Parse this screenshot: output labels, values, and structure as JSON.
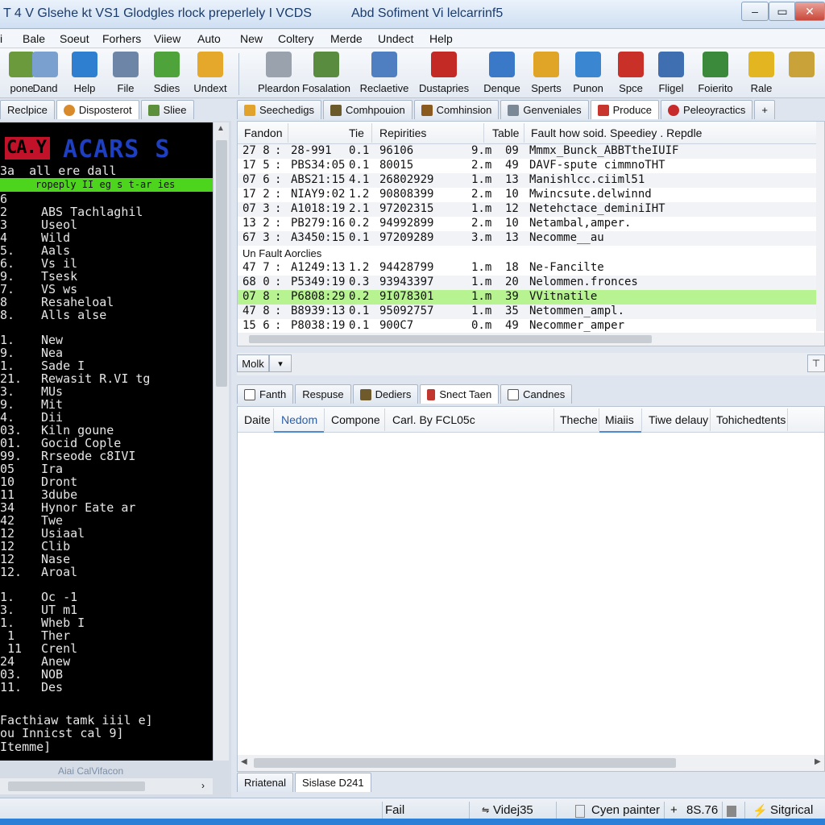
{
  "window": {
    "title_left": "T 4 V Glsehe kt VS1 Glodgles rlock preperlely I VCDS",
    "title_right": "Abd Sofiment Vi lelcarrinf5",
    "btn_min": "–",
    "btn_max": "▭",
    "btn_close": "✕"
  },
  "menu": [
    "Bale",
    "Soeut",
    "Forhers",
    "Viiew",
    "Auto",
    "New",
    "Coltery",
    "Merde",
    "Undect",
    "Help"
  ],
  "toolbar": [
    {
      "label": "pone",
      "icon": "globe-icon",
      "color": "#6a9a3c"
    },
    {
      "label": "Dand",
      "icon": "document-icon",
      "color": "#7aa0d0"
    },
    {
      "label": "Help",
      "icon": "help-globe-icon",
      "color": "#2f7fd0"
    },
    {
      "label": "File",
      "icon": "monitor-icon",
      "color": "#6d86a8"
    },
    {
      "label": "Sdies",
      "icon": "puzzle-icon",
      "color": "#4ea33a"
    },
    {
      "label": "Undext",
      "icon": "folder-icon",
      "color": "#e5a82b"
    },
    {
      "label": "Pleardon",
      "icon": "flask-icon",
      "color": "#9aa3ad"
    },
    {
      "label": "Fosalation",
      "icon": "chart-icon",
      "color": "#5a8c3f"
    },
    {
      "label": "Reclaetive",
      "icon": "screen-icon",
      "color": "#4f7fc0"
    },
    {
      "label": "Dustapries",
      "icon": "m-logo-icon",
      "color": "#c42a25"
    },
    {
      "label": "Denque",
      "icon": "question-doc-icon",
      "color": "#3a78c8"
    },
    {
      "label": "Sperts",
      "icon": "windows-icon",
      "color": "#e0a526"
    },
    {
      "label": "Punon",
      "icon": "orb-icon",
      "color": "#3a86d0"
    },
    {
      "label": "Spce",
      "icon": "stop-icon",
      "color": "#c93128"
    },
    {
      "label": "Fligel",
      "icon": "globe-stand-icon",
      "color": "#3f6fb0"
    },
    {
      "label": "Foierito",
      "icon": "bars-icon",
      "color": "#3b8a3b"
    },
    {
      "label": "Rale",
      "icon": "tag-icon",
      "color": "#e2b521"
    },
    {
      "label": "",
      "icon": "network-icon",
      "color": "#c9a23a"
    }
  ],
  "left_tabs": [
    {
      "label": "Reclpice",
      "icon": ""
    },
    {
      "label": "Disposterot",
      "icon": "gear-icon"
    },
    {
      "label": "Sliee",
      "icon": "grid-icon"
    }
  ],
  "right_tabs": [
    {
      "label": "Seechedigs",
      "icon": "pencil-icon"
    },
    {
      "label": "Comhpouion",
      "icon": "chip-icon"
    },
    {
      "label": "Comhinsion",
      "icon": "chip-icon"
    },
    {
      "label": "Genveniales",
      "icon": "table-icon"
    },
    {
      "label": "Produce",
      "icon": "flag-icon"
    },
    {
      "label": "Peleoyractics",
      "icon": "stop-icon"
    },
    {
      "label": "+",
      "icon": ""
    }
  ],
  "terminal": {
    "logo": "CA.Y",
    "logo2": "ACARS S",
    "header": "3a  all ere dall",
    "green_bar": "ropeply II  eg s t-ar ies",
    "rows": [
      {
        "n": "6",
        "t": ""
      },
      {
        "n": "2",
        "t": "ABS Tachlaghil"
      },
      {
        "n": "3",
        "t": "Useol"
      },
      {
        "n": "4",
        "t": "Wild"
      },
      {
        "n": "5.",
        "t": "Aals"
      },
      {
        "n": "6.",
        "t": "Vs il"
      },
      {
        "n": "9.",
        "t": "Tsesk"
      },
      {
        "n": "7.",
        "t": "VS ws"
      },
      {
        "n": "8",
        "t": "Resaheloal"
      },
      {
        "n": "8.",
        "t": "Alls alse"
      },
      {
        "n": "",
        "t": ""
      },
      {
        "n": "1.",
        "t": "New"
      },
      {
        "n": "9.",
        "t": "Nea"
      },
      {
        "n": "1.",
        "t": "Sade I"
      },
      {
        "n": "21.",
        "t": "Rewasit R.VI tg"
      },
      {
        "n": "3.",
        "t": "MUs"
      },
      {
        "n": "9.",
        "t": "Mit"
      },
      {
        "n": "4.",
        "t": "Dii"
      },
      {
        "n": "03.",
        "t": "Kiln goune"
      },
      {
        "n": "01.",
        "t": "Gocid Cople"
      },
      {
        "n": "99.",
        "t": "Rrseode c8IVI"
      },
      {
        "n": "05",
        "t": "Ira"
      },
      {
        "n": "10",
        "t": "Dront"
      },
      {
        "n": "11",
        "t": "3dube"
      },
      {
        "n": "34",
        "t": "Hynor Eate ar"
      },
      {
        "n": "42",
        "t": "Twe"
      },
      {
        "n": "12",
        "t": "Usiaal"
      },
      {
        "n": "12",
        "t": "Clib"
      },
      {
        "n": "12",
        "t": "Nase"
      },
      {
        "n": "12.",
        "t": "Aroal"
      },
      {
        "n": "",
        "t": ""
      },
      {
        "n": "1.",
        "t": "Oc -1"
      },
      {
        "n": "3.",
        "t": "UT m1"
      },
      {
        "n": "1.",
        "t": "Wheb I"
      },
      {
        "n": " 1",
        "t": "Ther"
      },
      {
        "n": " 11",
        "t": "Crenl"
      },
      {
        "n": "24",
        "t": "Anew"
      },
      {
        "n": "03.",
        "t": "NOB"
      },
      {
        "n": "11.",
        "t": "Des"
      }
    ],
    "footer": [
      "Facthiaw tamk iiil e]",
      "ou Innicst cal 9]",
      "Itemme]"
    ],
    "watermark": "Aiai CalVifacon"
  },
  "upper_table": {
    "headers": [
      "Fandon",
      "Tie",
      "Repirities",
      "Table",
      "Fault how soid. Speediey . Repdle"
    ],
    "rows": [
      {
        "a": "27 8",
        "b": ":",
        "c": "28-991",
        "d": "0.1",
        "e": "96106",
        "f": "9.m",
        "g": "09",
        "h": "Mmmx_Bunck_ABBTtheIUIF"
      },
      {
        "a": "17 5",
        "b": ":",
        "c": "PBS34:05",
        "d": "0.1",
        "e": "80015",
        "f": "2.m",
        "g": "49",
        "h": "DAVF-spute cimmnoTHT"
      },
      {
        "a": "07 6",
        "b": ":",
        "c": "ABS21:15",
        "d": "4.1",
        "e": "26802929",
        "f": "1.m",
        "g": "13",
        "h": "Manishlcc.ciiml51"
      },
      {
        "a": "17 2",
        "b": ":",
        "c": "NIAY9:02",
        "d": "1.2",
        "e": "90808399",
        "f": "2.m",
        "g": "10",
        "h": "Mwincsute.delwinnd"
      },
      {
        "a": "07 3",
        "b": ":",
        "c": "A1018:19",
        "d": "2.1",
        "e": "97202315",
        "f": "1.m",
        "g": "12",
        "h": "Netehctace_deminiIHT"
      },
      {
        "a": "13 2",
        "b": ":",
        "c": "PB279:16",
        "d": "0.2",
        "e": "94992899",
        "f": "2.m",
        "g": "10",
        "h": "Netambal,amper."
      },
      {
        "a": "67 3",
        "b": ":",
        "c": "A3450:15",
        "d": "0.1",
        "e": "97209289",
        "f": "3.m",
        "g": "13",
        "h": "Necomme__au"
      }
    ],
    "section": "Un Fault Aorclies",
    "rows2": [
      {
        "a": "47 7",
        "b": ":",
        "c": "A1249:13",
        "d": "1.2",
        "e": "94428799",
        "f": "1.m",
        "g": "18",
        "h": "Ne-Fancilte"
      },
      {
        "a": "68 0",
        "b": ":",
        "c": "P5349:19",
        "d": "0.3",
        "e": "93943397",
        "f": "1.m",
        "g": "20",
        "h": "Nelommen.fronces"
      },
      {
        "a": "07 8",
        "b": ":",
        "c": "P6808:29",
        "d": "0.2",
        "e": "9I078301",
        "f": "1.m",
        "g": "39",
        "h": "VVitnatile"
      },
      {
        "a": "47 8",
        "b": ":",
        "c": "B8939:13",
        "d": "0.1",
        "e": "95092757",
        "f": "1.m",
        "g": "35",
        "h": "Netommen_ampl."
      },
      {
        "a": "15 6",
        "b": ":",
        "c": "P8038:19",
        "d": "0.1",
        "e": "900C7",
        "f": "0.m",
        "g": "49",
        "h": "Necommer_amper"
      }
    ]
  },
  "mini_toolbar": {
    "label": "Molk",
    "dropdown": "▾",
    "pin": "⊤"
  },
  "lower_tabs": [
    {
      "label": "Fanth",
      "icon": "doc-icon"
    },
    {
      "label": "Respuse",
      "icon": ""
    },
    {
      "label": "Dediers",
      "icon": "chip-icon"
    },
    {
      "label": "Snect Taen",
      "icon": "pin-icon"
    },
    {
      "label": "Candnes",
      "icon": "doc-icon"
    }
  ],
  "lower_headers": [
    "Daite",
    "Nedom",
    "Compone",
    "Carl. By FCL05c",
    "Theche",
    "Miaiis",
    "Tiwe delauy",
    "Tohichedtents"
  ],
  "bottom_tabs": [
    "Rriatenal",
    "Sislase D241"
  ],
  "status": {
    "fail": "Fail",
    "video": "Videj35",
    "cyen": "Cyen painter",
    "val": "8S.76",
    "sig": "Sitgrical"
  }
}
